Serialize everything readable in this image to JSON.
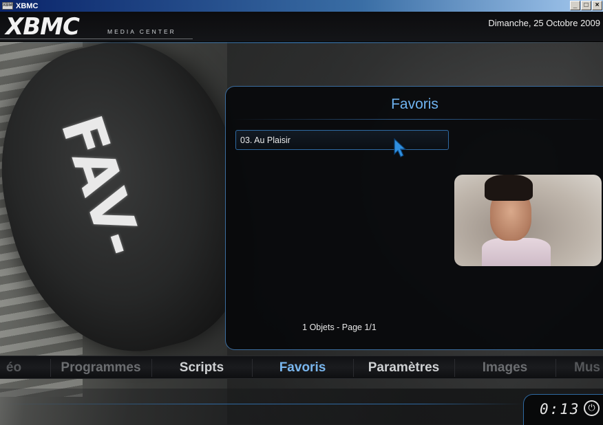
{
  "window": {
    "title": "XBMC",
    "icon_label": "XBMC",
    "buttons": [
      "_",
      "□",
      "×"
    ]
  },
  "header": {
    "logo": "XBMC",
    "logo_sub": "MEDIA CENTER",
    "date": "Dimanche, 25 Octobre 2009"
  },
  "background": {
    "knob_text": "FAV-"
  },
  "panel": {
    "title": "Favoris",
    "items": [
      {
        "label": "03. Au Plaisir"
      }
    ],
    "footer": "1 Objets - Page 1/1"
  },
  "nav": {
    "items": [
      {
        "label": "éo"
      },
      {
        "label": "Programmes"
      },
      {
        "label": "Scripts"
      },
      {
        "label": "Favoris"
      },
      {
        "label": "Paramètres"
      },
      {
        "label": "Images"
      },
      {
        "label": "Mus"
      }
    ],
    "active": "Favoris"
  },
  "status": {
    "clock": "0:13"
  },
  "colors": {
    "accent": "#6fb3f0",
    "border": "#2f6aa3",
    "panel_bg": "#08090b"
  }
}
